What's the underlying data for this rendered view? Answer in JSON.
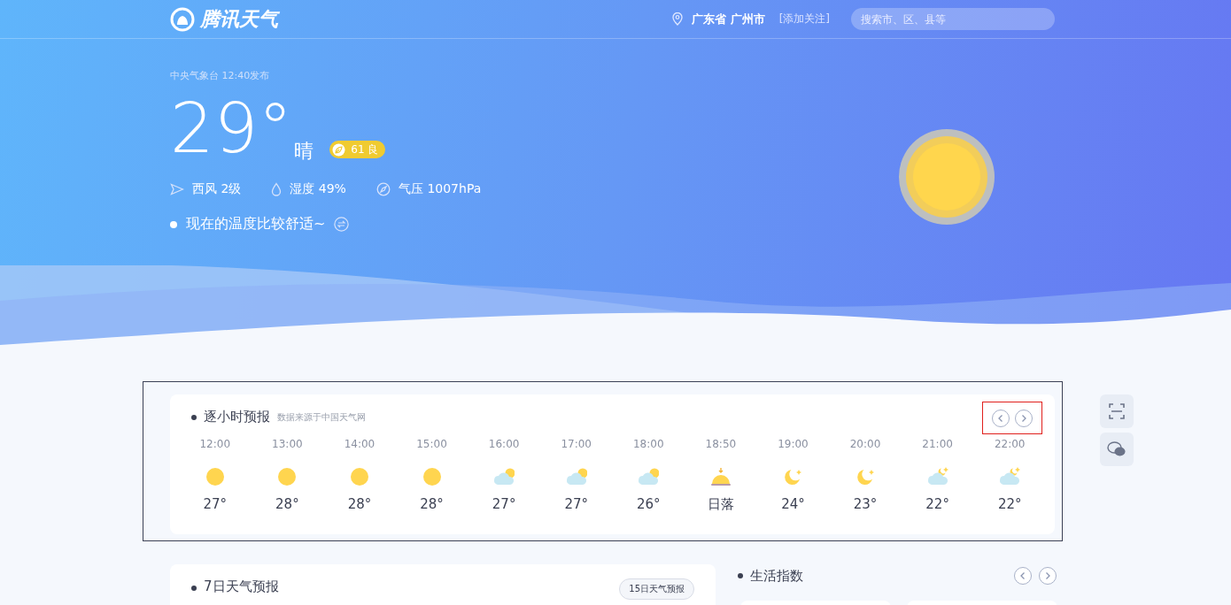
{
  "header": {
    "logo": "腾讯天气",
    "location": "广东省 广州市",
    "follow_link": "[添加关注]",
    "search": {
      "placeholder": "搜索市、区、县等"
    }
  },
  "current": {
    "publisher": "中央气象台 12:40发布",
    "temperature": "29°",
    "condition": "晴",
    "aqi": "61 良",
    "details": [
      {
        "kind": "wind",
        "text": "西风 2级"
      },
      {
        "kind": "humidity",
        "text": "湿度 49%"
      },
      {
        "kind": "pressure",
        "text": "气压 1007hPa"
      }
    ],
    "tip": "现在的温度比较舒适~"
  },
  "hourly": {
    "title": "逐小时预报",
    "source": "数据来源于中国天气网",
    "items": [
      {
        "time": "12:00",
        "kind": "sun",
        "value": "27°"
      },
      {
        "time": "13:00",
        "kind": "sun",
        "value": "28°"
      },
      {
        "time": "14:00",
        "kind": "sun",
        "value": "28°"
      },
      {
        "time": "15:00",
        "kind": "sun",
        "value": "28°"
      },
      {
        "time": "16:00",
        "kind": "cloud-sun",
        "value": "27°"
      },
      {
        "time": "17:00",
        "kind": "cloud-sun",
        "value": "27°"
      },
      {
        "time": "18:00",
        "kind": "cloud-sun",
        "value": "26°"
      },
      {
        "time": "18:50",
        "kind": "sunset",
        "value": "日落"
      },
      {
        "time": "19:00",
        "kind": "moon",
        "value": "24°"
      },
      {
        "time": "20:00",
        "kind": "moon",
        "value": "23°"
      },
      {
        "time": "21:00",
        "kind": "cloud-moon",
        "value": "22°"
      },
      {
        "time": "22:00",
        "kind": "cloud-moon",
        "value": "22°"
      }
    ]
  },
  "weekly": {
    "title": "7日天气预报",
    "button": "15日天气预报"
  },
  "life_index": {
    "title": "生活指数"
  }
}
